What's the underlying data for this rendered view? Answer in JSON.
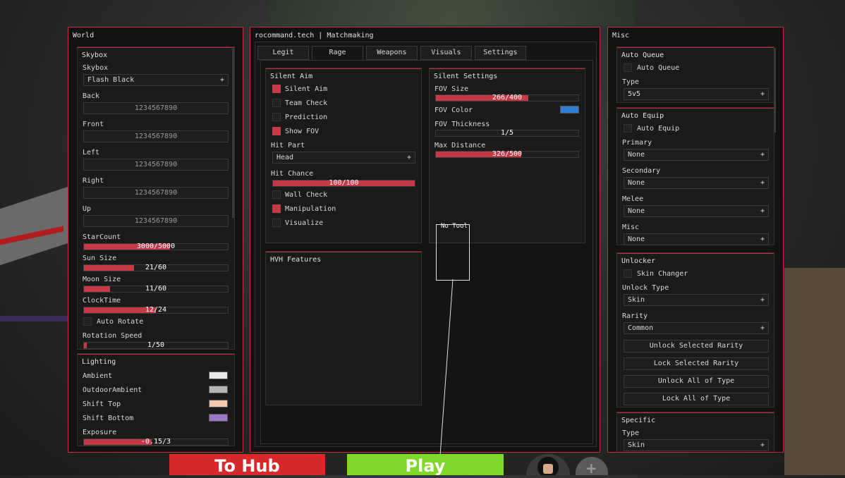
{
  "world": {
    "title": "World",
    "skybox": {
      "title": "Skybox",
      "skybox_label": "Skybox",
      "skybox_value": "Flash Black",
      "back_label": "Back",
      "back_value": "1234567890",
      "front_label": "Front",
      "front_value": "1234567890",
      "left_label": "Left",
      "left_value": "1234567890",
      "right_label": "Right",
      "right_value": "1234567890",
      "up_label": "Up",
      "up_value": "1234567890",
      "starcount_label": "StarCount",
      "starcount_value": "3000/5000",
      "starcount_fraction": 0.6,
      "sunsize_label": "Sun Size",
      "sunsize_value": "21/60",
      "sunsize_fraction": 0.35,
      "moonsize_label": "Moon Size",
      "moonsize_value": "11/60",
      "moonsize_fraction": 0.18,
      "clocktime_label": "ClockTime",
      "clocktime_value": "12/24",
      "clocktime_fraction": 0.5,
      "autorotate_label": "Auto Rotate",
      "rotspeed_label": "Rotation Speed",
      "rotspeed_value": "1/50",
      "rotspeed_fraction": 0.02
    },
    "lighting": {
      "title": "Lighting",
      "ambient_label": "Ambient",
      "ambient_color": "#e8e8e8",
      "outdoor_label": "OutdoorAmbient",
      "outdoor_color": "#b5b5b5",
      "shifttop_label": "Shift Top",
      "shifttop_color": "#f0c8b0",
      "shiftbottom_label": "Shift Bottom",
      "shiftbottom_color": "#9a7ac8",
      "exposure_label": "Exposure",
      "exposure_value": "-0.15/3",
      "exposure_fraction": 0.47
    }
  },
  "main": {
    "title": "rocommand.tech | Matchmaking",
    "tabs": [
      "Legit",
      "Rage",
      "Weapons",
      "Visuals",
      "Settings"
    ],
    "silent_aim": {
      "title": "Silent Aim",
      "silent_aim_label": "Silent Aim",
      "team_check_label": "Team Check",
      "prediction_label": "Prediction",
      "show_fov_label": "Show FOV",
      "hit_part_label": "Hit Part",
      "hit_part_value": "Head",
      "hit_chance_label": "Hit Chance",
      "hit_chance_value": "100/100",
      "hit_chance_fraction": 1.0,
      "wall_check_label": "Wall Check",
      "manipulation_label": "Manipulation",
      "visualize_label": "Visualize"
    },
    "silent_settings": {
      "title": "Silent Settings",
      "fov_size_label": "FOV Size",
      "fov_size_value": "266/400",
      "fov_size_fraction": 0.65,
      "fov_color_label": "FOV Color",
      "fov_color": "#2f7fd8",
      "fov_thickness_label": "FOV Thickness",
      "fov_thickness_value": "1/5",
      "fov_thickness_fraction": 0.0,
      "max_distance_label": "Max Distance",
      "max_distance_value": "326/500",
      "max_distance_fraction": 0.6
    },
    "hvh": {
      "title": "HVH Features"
    },
    "tool_label": "No Tool"
  },
  "misc": {
    "title": "Misc",
    "auto_queue": {
      "title": "Auto Queue",
      "toggle_label": "Auto Queue",
      "type_label": "Type",
      "type_value": "5v5"
    },
    "auto_equip": {
      "title": "Auto Equip",
      "toggle_label": "Auto Equip",
      "primary_label": "Primary",
      "primary_value": "None",
      "secondary_label": "Secondary",
      "secondary_value": "None",
      "melee_label": "Melee",
      "melee_value": "None",
      "misc_label": "Misc",
      "misc_value": "None"
    },
    "unlocker": {
      "title": "Unlocker",
      "skin_changer_label": "Skin Changer",
      "unlock_type_label": "Unlock Type",
      "unlock_type_value": "Skin",
      "rarity_label": "Rarity",
      "rarity_value": "Common",
      "buttons": [
        "Unlock Selected Rarity",
        "Lock Selected Rarity",
        "Unlock All of Type",
        "Lock All of Type"
      ]
    },
    "specific": {
      "title": "Specific",
      "type_label": "Type",
      "type_value": "Skin"
    }
  },
  "game": {
    "to_hub_label": "To Hub",
    "play_label": "Play"
  },
  "colors": {
    "accent": "#c23a48",
    "border": "#c0303a",
    "hub": "#d8282c",
    "play": "#7fd828"
  }
}
